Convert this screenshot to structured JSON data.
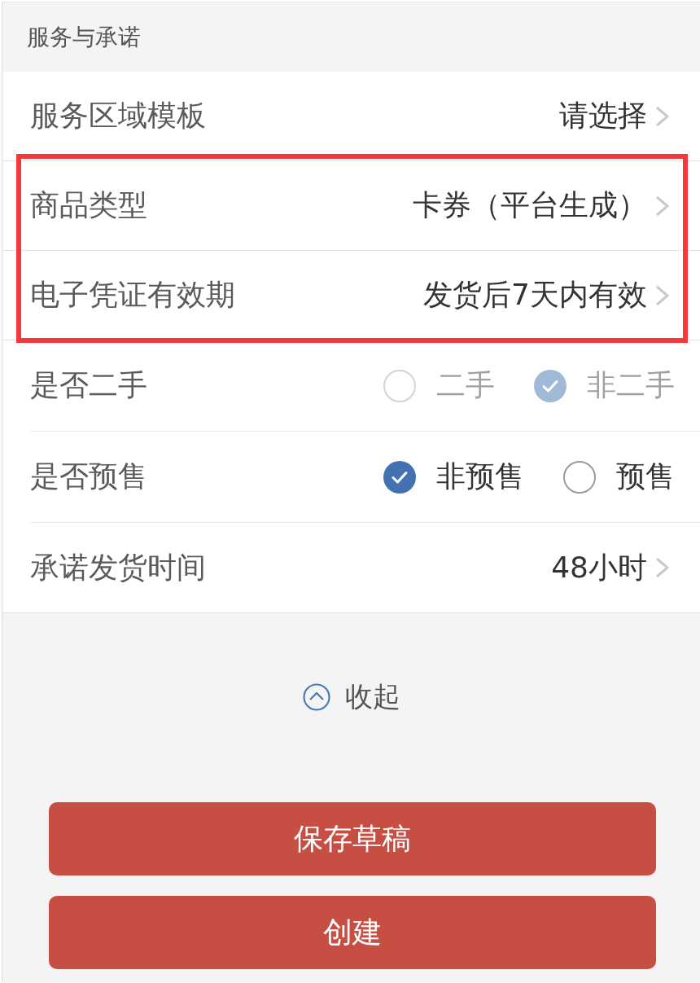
{
  "section": {
    "title": "服务与承诺"
  },
  "rows": [
    {
      "kind": "select",
      "label": "服务区域模板",
      "value": "请选择",
      "highlighted": false
    },
    {
      "kind": "select",
      "label": "商品类型",
      "value": "卡券（平台生成）",
      "highlighted": true
    },
    {
      "kind": "select",
      "label": "电子凭证有效期",
      "value": "发货后7天内有效",
      "highlighted": true
    },
    {
      "kind": "radio",
      "label": "是否二手",
      "disabled": true,
      "highlighted": false,
      "options": [
        {
          "label": "二手",
          "selected": false
        },
        {
          "label": "非二手",
          "selected": true
        }
      ]
    },
    {
      "kind": "radio",
      "label": "是否预售",
      "disabled": false,
      "highlighted": false,
      "options": [
        {
          "label": "非预售",
          "selected": true
        },
        {
          "label": "预售",
          "selected": false
        }
      ]
    },
    {
      "kind": "select",
      "label": "承诺发货时间",
      "value": "48小时",
      "highlighted": false
    }
  ],
  "collapse": {
    "label": "收起",
    "expanded": true
  },
  "buttons": [
    {
      "label": "保存草稿"
    },
    {
      "label": "创建"
    }
  ]
}
